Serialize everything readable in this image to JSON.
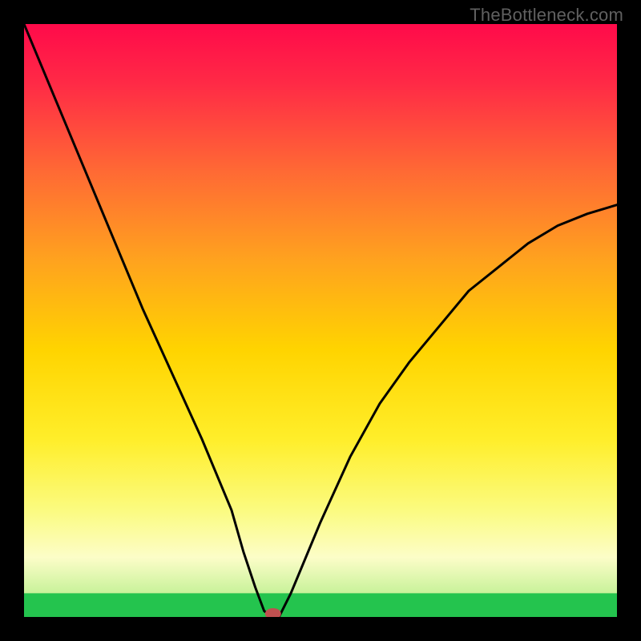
{
  "watermark": "TheBottleneck.com",
  "chart_data": {
    "type": "line",
    "title": "",
    "xlabel": "",
    "ylabel": "",
    "xlim": [
      0,
      100
    ],
    "ylim": [
      0,
      100
    ],
    "grid": false,
    "legend": false,
    "series": [
      {
        "name": "bottleneck-curve",
        "x": [
          0,
          5,
          10,
          15,
          20,
          25,
          30,
          35,
          37,
          39,
          40.5,
          42,
          43,
          45,
          50,
          55,
          60,
          65,
          70,
          75,
          80,
          85,
          90,
          95,
          100
        ],
        "values": [
          100,
          88,
          76,
          64,
          52,
          41,
          30,
          18,
          11,
          5,
          1,
          0,
          0,
          4,
          16,
          27,
          36,
          43,
          49,
          55,
          59,
          63,
          66,
          68,
          69.5
        ]
      }
    ],
    "marker": {
      "x": 42,
      "y": 0
    },
    "green_band_fraction": 0.04,
    "gradient_stops": [
      {
        "t": 0.0,
        "c": "#ff0a4a"
      },
      {
        "t": 0.1,
        "c": "#ff2a46"
      },
      {
        "t": 0.25,
        "c": "#ff6a34"
      },
      {
        "t": 0.4,
        "c": "#ffa31e"
      },
      {
        "t": 0.55,
        "c": "#ffd400"
      },
      {
        "t": 0.7,
        "c": "#ffee2a"
      },
      {
        "t": 0.82,
        "c": "#fbfb80"
      },
      {
        "t": 0.9,
        "c": "#fcfdc8"
      },
      {
        "t": 0.96,
        "c": "#c8f29a"
      },
      {
        "t": 0.985,
        "c": "#66d96a"
      },
      {
        "t": 1.0,
        "c": "#24c44e"
      }
    ]
  }
}
